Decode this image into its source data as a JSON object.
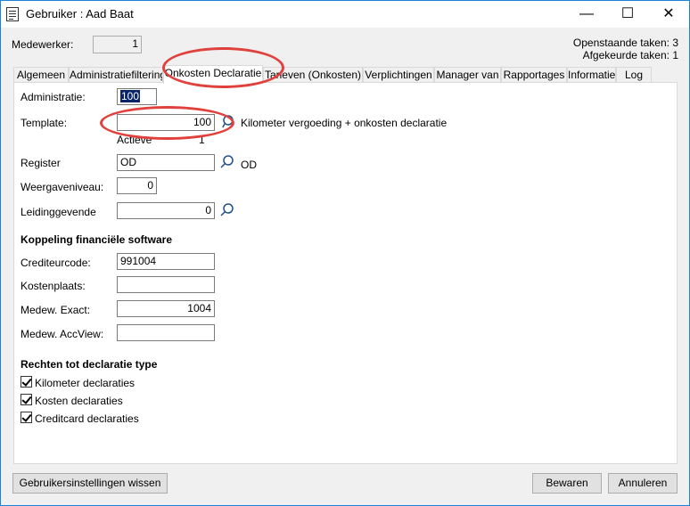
{
  "window": {
    "title": "Gebruiker : Aad Baat",
    "controls": {
      "minimize": "—",
      "maximize": "☐",
      "close": "✕"
    }
  },
  "header": {
    "medewerker_label": "Medewerker:",
    "medewerker_value": "1",
    "openstaande_taken": "Openstaande taken: 3",
    "afgekeurde_taken": "Afgekeurde taken: 1"
  },
  "tabs": [
    {
      "label": "Algemeen"
    },
    {
      "label": "Administratiefiltering"
    },
    {
      "label": "Onkosten Declaratie"
    },
    {
      "label": "Tarieven (Onkosten)"
    },
    {
      "label": "Verplichtingen"
    },
    {
      "label": "Manager van"
    },
    {
      "label": "Rapportages"
    },
    {
      "label": "Informatie"
    },
    {
      "label": "Log"
    }
  ],
  "active_tab": "Onkosten Declaratie",
  "form": {
    "administratie": {
      "label": "Administratie:",
      "value": "100"
    },
    "template": {
      "label": "Template:",
      "value": "100",
      "description": "Kilometer vergoeding + onkosten declaratie",
      "actief_label": "Actieve",
      "actief_value": "1"
    },
    "register": {
      "label": "Register",
      "value": "OD",
      "description": "OD"
    },
    "weergaveniveau": {
      "label": "Weergaveniveau:",
      "value": "0"
    },
    "leidinggevende": {
      "label": "Leidinggevende",
      "value": "0"
    }
  },
  "koppeling": {
    "heading": "Koppeling financiële software",
    "crediteurcode": {
      "label": "Crediteurcode:",
      "value": "991004"
    },
    "kostenplaats": {
      "label": "Kostenplaats:",
      "value": ""
    },
    "medew_exact": {
      "label": "Medew. Exact:",
      "value": "1004"
    },
    "medew_accview": {
      "label": "Medew. AccView:",
      "value": ""
    }
  },
  "rechten": {
    "heading": "Rechten tot declaratie type",
    "items": [
      {
        "label": "Kilometer declaraties",
        "checked": true
      },
      {
        "label": "Kosten declaraties",
        "checked": true
      },
      {
        "label": "Creditcard declaraties",
        "checked": true
      }
    ]
  },
  "footer": {
    "reset_button": "Gebruikersinstellingen wissen",
    "save_button": "Bewaren",
    "cancel_button": "Annuleren"
  },
  "colors": {
    "accent": "#1883d7",
    "annotation": "#e0413c",
    "selection": "#0a246a"
  }
}
